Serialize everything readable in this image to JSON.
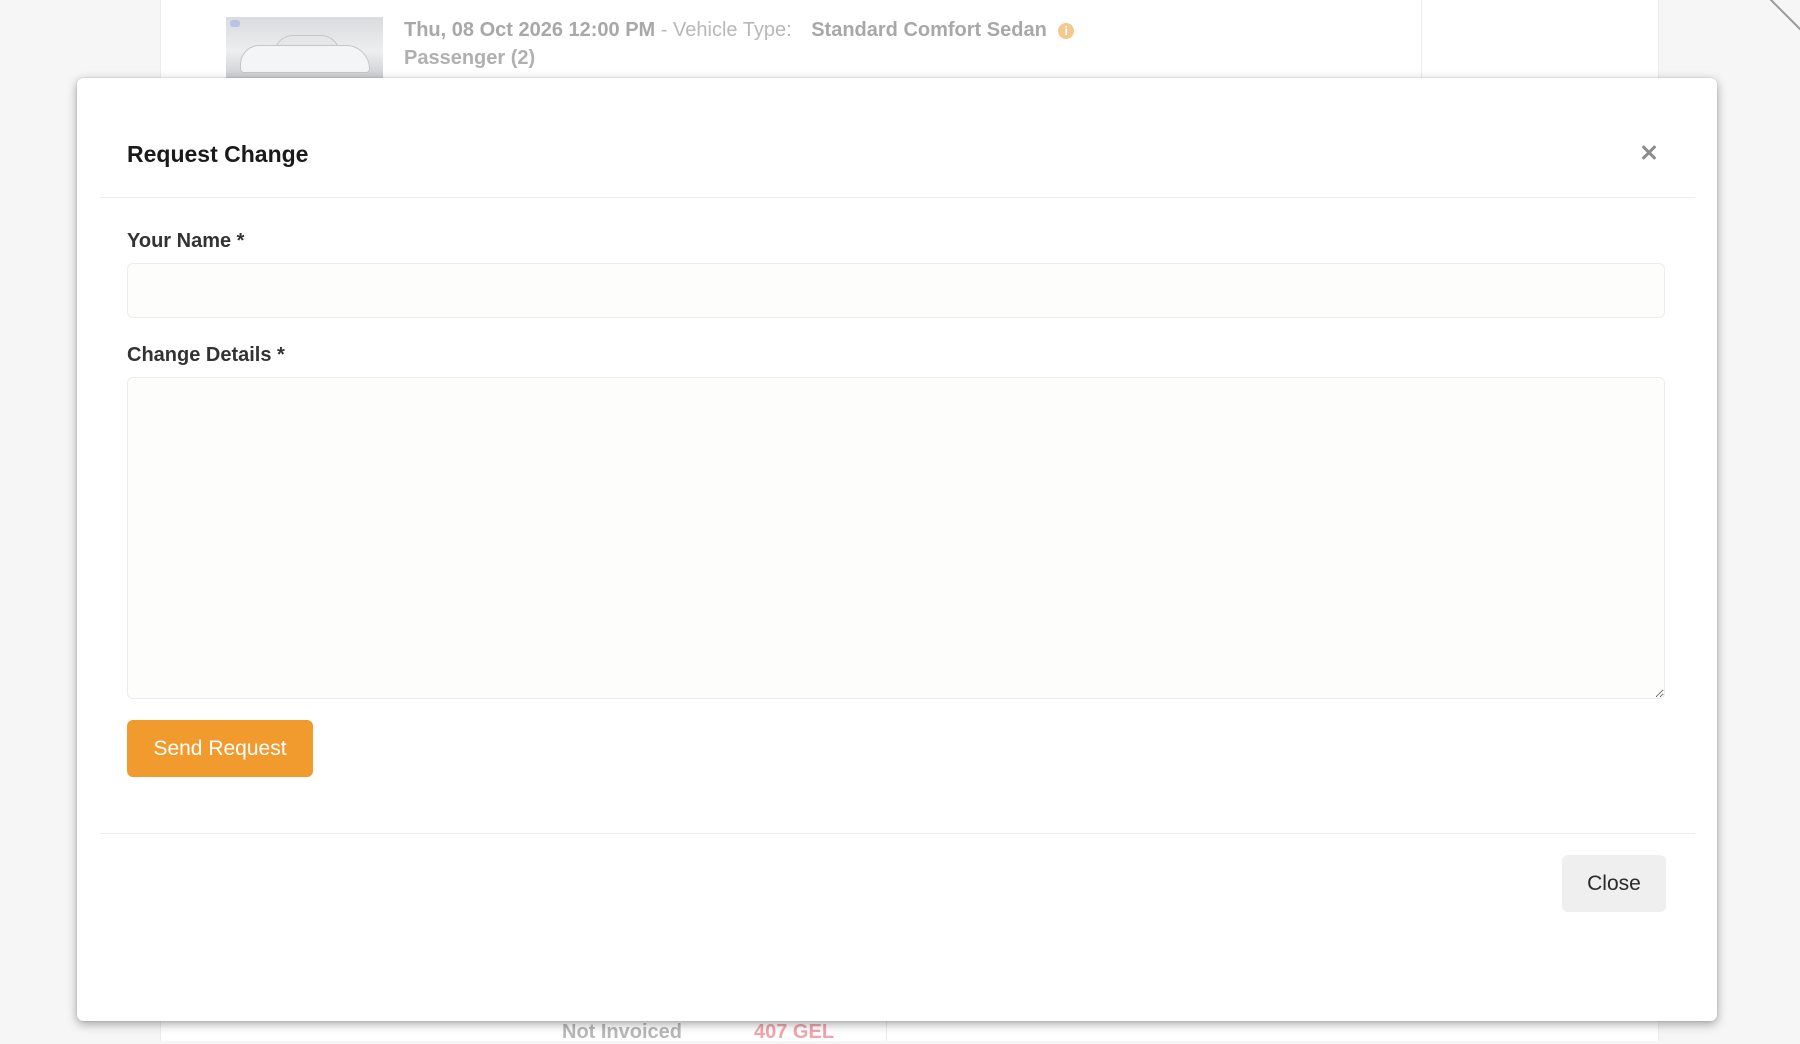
{
  "background": {
    "booking": {
      "datetime": "Thu, 08 Oct 2026 12:00 PM",
      "separator": "-",
      "vehicle_type_label": "Vehicle Type:",
      "vehicle_type_value": "Standard Comfort Sedan",
      "info_icon": "info-icon",
      "passengers": "Passenger (2)"
    },
    "invoice": {
      "status": "Not Invoiced",
      "amount": "407 GEL"
    }
  },
  "modal": {
    "title": "Request Change",
    "close_icon": "close-icon",
    "fields": {
      "name": {
        "label": "Your Name *",
        "value": "",
        "placeholder": ""
      },
      "details": {
        "label": "Change Details *",
        "value": "",
        "placeholder": ""
      }
    },
    "send_button": "Send Request",
    "close_button": "Close"
  },
  "colors": {
    "accent": "#f19a2d",
    "amount_text": "#f0a5ad",
    "info_badge": "#f3c98f"
  }
}
